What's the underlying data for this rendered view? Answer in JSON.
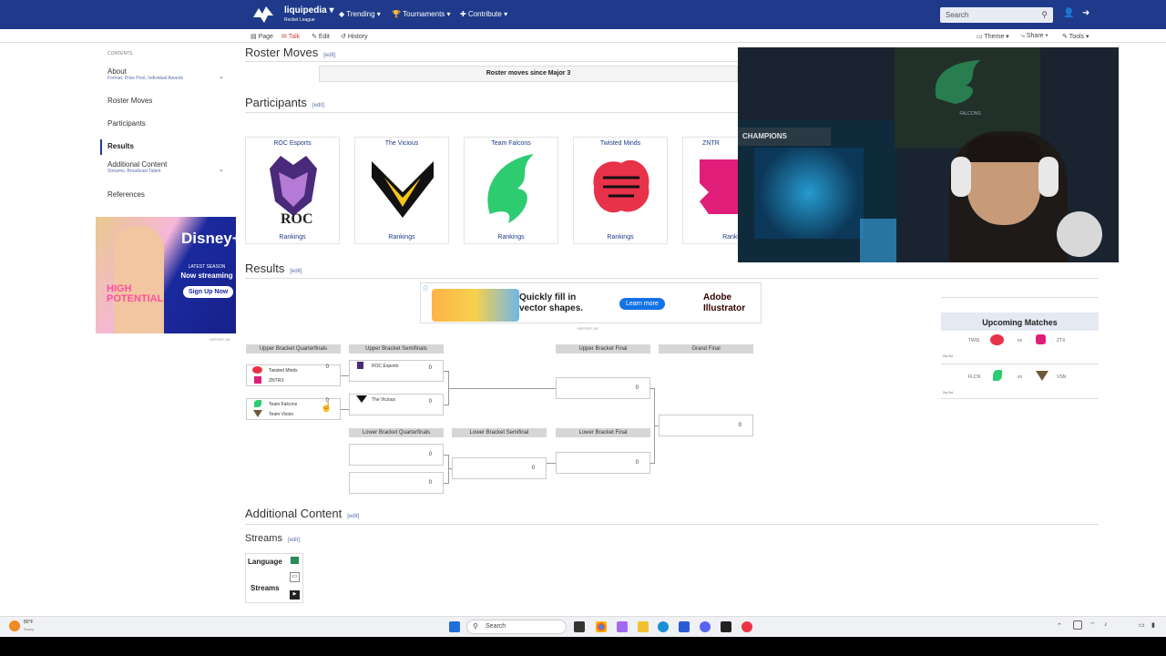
{
  "topbar": {
    "brand": "liquipedia",
    "brand_sub": "Rocket League",
    "nav": [
      "Trending",
      "Tournaments",
      "Contribute"
    ],
    "search_placeholder": "Search"
  },
  "subbar": {
    "left": [
      "Page",
      "Talk",
      "Edit",
      "History"
    ],
    "right": [
      "Theme",
      "Share",
      "Tools"
    ]
  },
  "sidebar": {
    "contents": "CONTENTS",
    "items": [
      {
        "label": "About",
        "sub": "Format, Prize Pool, Individual Awards"
      },
      {
        "label": "Roster Moves",
        "sub": ""
      },
      {
        "label": "Participants",
        "sub": ""
      },
      {
        "label": "Results",
        "sub": ""
      },
      {
        "label": "Additional Content",
        "sub": "Streams, Broadcast Talent"
      },
      {
        "label": "References",
        "sub": ""
      }
    ]
  },
  "ad1": {
    "brand": "Disney+",
    "line1": "LATEST SEASON",
    "line2": "Now streaming",
    "cta": "Sign Up Now",
    "title": "HIGH POTENTIAL",
    "report": "REPORT AD"
  },
  "sections": {
    "roster": "Roster Moves",
    "participants": "Participants",
    "results": "Results",
    "additional": "Additional Content",
    "streams": "Streams",
    "edit": "[edit]"
  },
  "roster_box": "Roster moves since Major 3",
  "teams": [
    {
      "name": "ROC Esports",
      "rank": "Rankings"
    },
    {
      "name": "The Vicious",
      "rank": "Rankings"
    },
    {
      "name": "Team Falcons",
      "rank": "Rankings"
    },
    {
      "name": "Twisted Minds",
      "rank": "Rankings"
    },
    {
      "name": "ZNTR",
      "rank": "Ranki"
    }
  ],
  "ad2": {
    "text1": "Quickly fill in",
    "text2": "vector shapes.",
    "cta": "Learn more",
    "brand1": "Adobe",
    "brand2": "Illustrator",
    "report": "REPORT AD"
  },
  "bracket": {
    "headers": {
      "ubqf": "Upper Bracket Quarterfinals",
      "ubsf": "Upper Bracket Semifinals",
      "ubf": "Upper Bracket Final",
      "gf": "Grand Final",
      "lbqf": "Lower Bracket Quarterfinals",
      "lbsf": "Lower Bracket Semifinal",
      "lbf": "Lower Bracket Final"
    },
    "m1": [
      "Twisted Minds",
      "ZNTRX"
    ],
    "m2": [
      "Team Falcons",
      "Team Vision"
    ],
    "s1": "ROC Esports",
    "s2": "The Vicious",
    "score": "0"
  },
  "upcoming": {
    "title": "Upcoming Matches",
    "m1": {
      "t1": "TWIS",
      "t2": "ZTX",
      "vs": "vs",
      "time": "2w 0d"
    },
    "m2": {
      "t1": "FLCN",
      "t2": "VSN",
      "vs": "vs",
      "time": "2w 0d"
    }
  },
  "streams_table": {
    "language": "Language",
    "streams": "Streams"
  },
  "taskbar": {
    "search": "Search",
    "weather": "80°F",
    "weather_sub": "Sunny"
  },
  "colors": {
    "brand": "#1f3a8a",
    "link": "#5a6ea8"
  }
}
